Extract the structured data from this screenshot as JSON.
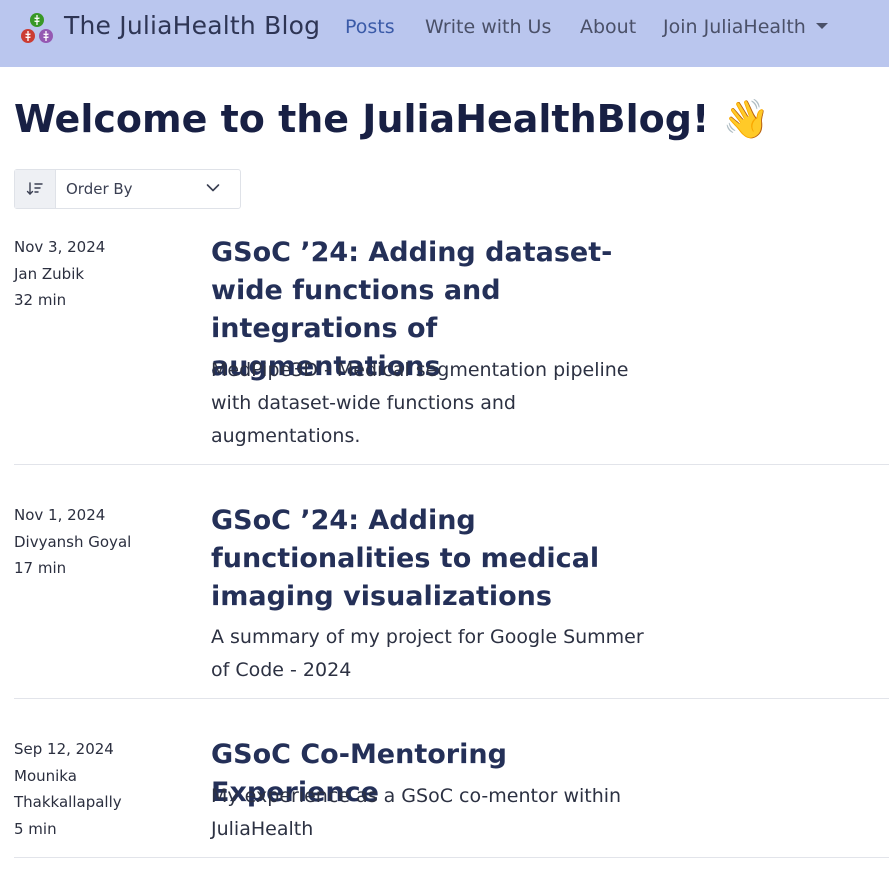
{
  "navbar": {
    "brand": "The JuliaHealth Blog",
    "logo_icon": "julia-health-logo-icon",
    "items": [
      {
        "label": "Posts",
        "active": true
      },
      {
        "label": "Write with Us",
        "active": false
      },
      {
        "label": "About",
        "active": false
      },
      {
        "label": "Join JuliaHealth",
        "active": false,
        "dropdown": true
      }
    ],
    "background": "#bac6ee",
    "active_color": "#3a5aa8"
  },
  "page": {
    "title": "Welcome to the JuliaHealthBlog!",
    "title_emoji": "👋"
  },
  "order_by": {
    "icon": "sort-icon",
    "label": "Order By",
    "chevron": "chevron-down-icon"
  },
  "posts": [
    {
      "date": "Nov 3, 2024",
      "author": "Jan Zubik",
      "reading_time": "32 min",
      "title": "GSoC ’24: Adding dataset-wide functions and integrations of augmentations",
      "description": "MedPipe3D - Medical segmentation pipeline with dataset-wide functions and augmentations."
    },
    {
      "date": "Nov 1, 2024",
      "author": "Divyansh Goyal",
      "reading_time": "17 min",
      "title": "GSoC ’24: Adding functionalities to medical imaging visualizations",
      "description": "A summary of my project for Google Summer of Code - 2024"
    },
    {
      "date": "Sep 12, 2024",
      "author": "Mounika Thakkallapally",
      "reading_time": "5 min",
      "title": "GSoC Co-Mentoring Experience",
      "description": "My experience as a GSoC co-mentor within JuliaHealth"
    }
  ]
}
